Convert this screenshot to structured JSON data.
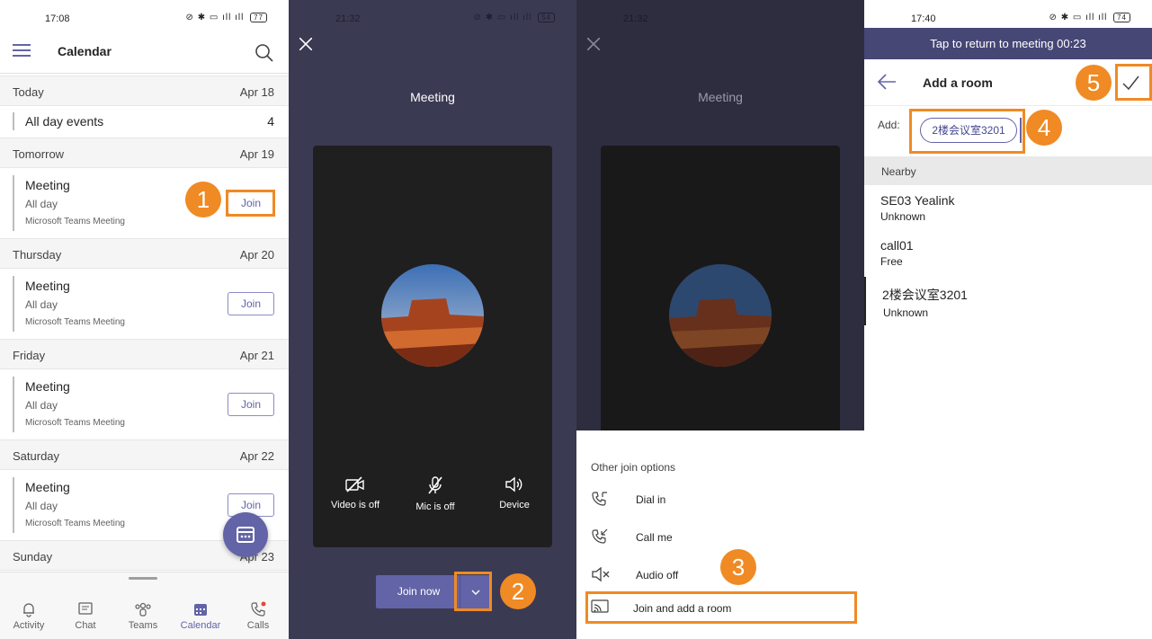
{
  "colors": {
    "brand": "#6264a7",
    "highlight": "#f08a24"
  },
  "panel1": {
    "status_time": "17:08",
    "battery": "77",
    "title": "Calendar",
    "sections": [
      {
        "label": "Today",
        "date": "Apr 18"
      },
      {
        "label": "Tomorrow",
        "date": "Apr 19"
      },
      {
        "label": "Thursday",
        "date": "Apr 20"
      },
      {
        "label": "Friday",
        "date": "Apr 21"
      },
      {
        "label": "Saturday",
        "date": "Apr 22"
      },
      {
        "label": "Sunday",
        "date": "Apr 23"
      }
    ],
    "all_day": {
      "label": "All day events",
      "count": "4"
    },
    "events": [
      {
        "title": "Meeting",
        "duration": "All day",
        "subtitle": "Microsoft Teams Meeting",
        "join": "Join"
      },
      {
        "title": "Meeting",
        "duration": "All day",
        "subtitle": "Microsoft Teams Meeting",
        "join": "Join"
      },
      {
        "title": "Meeting",
        "duration": "All day",
        "subtitle": "Microsoft Teams Meeting",
        "join": "Join"
      },
      {
        "title": "Meeting",
        "duration": "All day",
        "subtitle": "Microsoft Teams Meeting",
        "join": "Join"
      }
    ],
    "tabs": [
      {
        "label": "Activity",
        "icon": "bell-icon"
      },
      {
        "label": "Chat",
        "icon": "chat-icon"
      },
      {
        "label": "Teams",
        "icon": "teams-icon"
      },
      {
        "label": "Calendar",
        "icon": "calendar-icon",
        "active": true
      },
      {
        "label": "Calls",
        "icon": "phone-icon"
      }
    ]
  },
  "panel2": {
    "status_time": "21:32",
    "battery": "54",
    "title": "Meeting",
    "controls": [
      {
        "label": "Video is off",
        "icon": "video-off-icon"
      },
      {
        "label": "Mic is off",
        "icon": "mic-off-icon"
      },
      {
        "label": "Device",
        "icon": "speaker-icon"
      }
    ],
    "join_now": "Join now"
  },
  "panel3": {
    "status_time": "21:32",
    "title": "Meeting",
    "sheet_title": "Other join options",
    "options": [
      {
        "label": "Dial in",
        "icon": "phone-incoming-icon"
      },
      {
        "label": "Call me",
        "icon": "phone-outgoing-icon"
      },
      {
        "label": "Audio off",
        "icon": "speaker-mute-icon"
      },
      {
        "label": "Join and add a room",
        "icon": "cast-icon"
      }
    ]
  },
  "panel4": {
    "status_time": "17:40",
    "battery": "74",
    "return_bar": "Tap to return to meeting 00:23",
    "title": "Add a room",
    "add_label": "Add:",
    "chip": "2楼会议室3201",
    "nearby_label": "Nearby",
    "rooms": [
      {
        "name": "SE03 Yealink",
        "status": "Unknown"
      },
      {
        "name": "call01",
        "status": "Free"
      },
      {
        "name": "2楼会议室3201",
        "status": "Unknown"
      }
    ]
  },
  "badges": [
    "1",
    "2",
    "3",
    "4",
    "5"
  ]
}
